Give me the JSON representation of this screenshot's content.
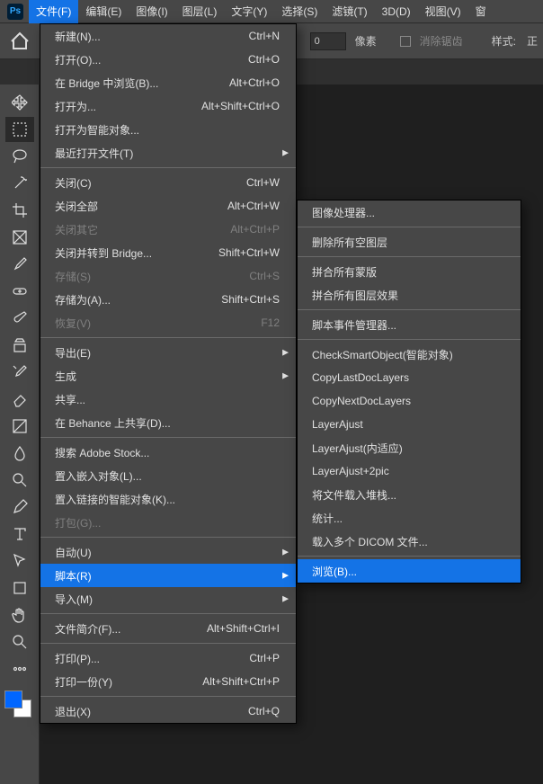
{
  "ps_logo": "Ps",
  "menubar": {
    "items": [
      "文件(F)",
      "编辑(E)",
      "图像(I)",
      "图层(L)",
      "文字(Y)",
      "选择(S)",
      "滤镜(T)",
      "3D(D)",
      "视图(V)",
      "窗"
    ]
  },
  "options": {
    "pixel_label": "像素",
    "pixel_value": "0",
    "antialias": "消除锯齿",
    "style_label": "样式:",
    "style_value": "正"
  },
  "file_menu": [
    {
      "label": "新建(N)...",
      "shortcut": "Ctrl+N"
    },
    {
      "label": "打开(O)...",
      "shortcut": "Ctrl+O"
    },
    {
      "label": "在 Bridge 中浏览(B)...",
      "shortcut": "Alt+Ctrl+O"
    },
    {
      "label": "打开为...",
      "shortcut": "Alt+Shift+Ctrl+O"
    },
    {
      "label": "打开为智能对象..."
    },
    {
      "label": "最近打开文件(T)",
      "submenu": true
    },
    {
      "sep": true
    },
    {
      "label": "关闭(C)",
      "shortcut": "Ctrl+W"
    },
    {
      "label": "关闭全部",
      "shortcut": "Alt+Ctrl+W"
    },
    {
      "label": "关闭其它",
      "shortcut": "Alt+Ctrl+P",
      "disabled": true
    },
    {
      "label": "关闭并转到 Bridge...",
      "shortcut": "Shift+Ctrl+W"
    },
    {
      "label": "存储(S)",
      "shortcut": "Ctrl+S",
      "disabled": true
    },
    {
      "label": "存储为(A)...",
      "shortcut": "Shift+Ctrl+S"
    },
    {
      "label": "恢复(V)",
      "shortcut": "F12",
      "disabled": true
    },
    {
      "sep": true
    },
    {
      "label": "导出(E)",
      "submenu": true
    },
    {
      "label": "生成",
      "submenu": true
    },
    {
      "label": "共享..."
    },
    {
      "label": "在 Behance 上共享(D)..."
    },
    {
      "sep": true
    },
    {
      "label": "搜索 Adobe Stock..."
    },
    {
      "label": "置入嵌入对象(L)..."
    },
    {
      "label": "置入链接的智能对象(K)..."
    },
    {
      "label": "打包(G)...",
      "disabled": true
    },
    {
      "sep": true
    },
    {
      "label": "自动(U)",
      "submenu": true
    },
    {
      "label": "脚本(R)",
      "submenu": true,
      "highlight": true
    },
    {
      "label": "导入(M)",
      "submenu": true
    },
    {
      "sep": true
    },
    {
      "label": "文件简介(F)...",
      "shortcut": "Alt+Shift+Ctrl+I"
    },
    {
      "sep": true
    },
    {
      "label": "打印(P)...",
      "shortcut": "Ctrl+P"
    },
    {
      "label": "打印一份(Y)",
      "shortcut": "Alt+Shift+Ctrl+P"
    },
    {
      "sep": true
    },
    {
      "label": "退出(X)",
      "shortcut": "Ctrl+Q"
    }
  ],
  "script_submenu": [
    {
      "label": "图像处理器..."
    },
    {
      "sep": true
    },
    {
      "label": "删除所有空图层"
    },
    {
      "sep": true
    },
    {
      "label": "拼合所有蒙版"
    },
    {
      "label": "拼合所有图层效果"
    },
    {
      "sep": true
    },
    {
      "label": "脚本事件管理器..."
    },
    {
      "sep": true
    },
    {
      "label": "CheckSmartObject(智能对象)"
    },
    {
      "label": "CopyLastDocLayers"
    },
    {
      "label": "CopyNextDocLayers"
    },
    {
      "label": "LayerAjust"
    },
    {
      "label": "LayerAjust(内适应)"
    },
    {
      "label": "LayerAjust+2pic"
    },
    {
      "label": "将文件载入堆栈..."
    },
    {
      "label": "统计..."
    },
    {
      "label": "载入多个 DICOM 文件..."
    },
    {
      "sep": true
    },
    {
      "label": "浏览(B)...",
      "highlight": true
    }
  ],
  "tools": [
    "move",
    "marquee",
    "lasso",
    "magic-wand",
    "crop",
    "frame",
    "eyedropper",
    "healing",
    "brush",
    "clone",
    "history-brush",
    "eraser",
    "gradient",
    "blur",
    "dodge",
    "pen",
    "type",
    "path-select",
    "rectangle",
    "hand",
    "zoom",
    "more"
  ]
}
